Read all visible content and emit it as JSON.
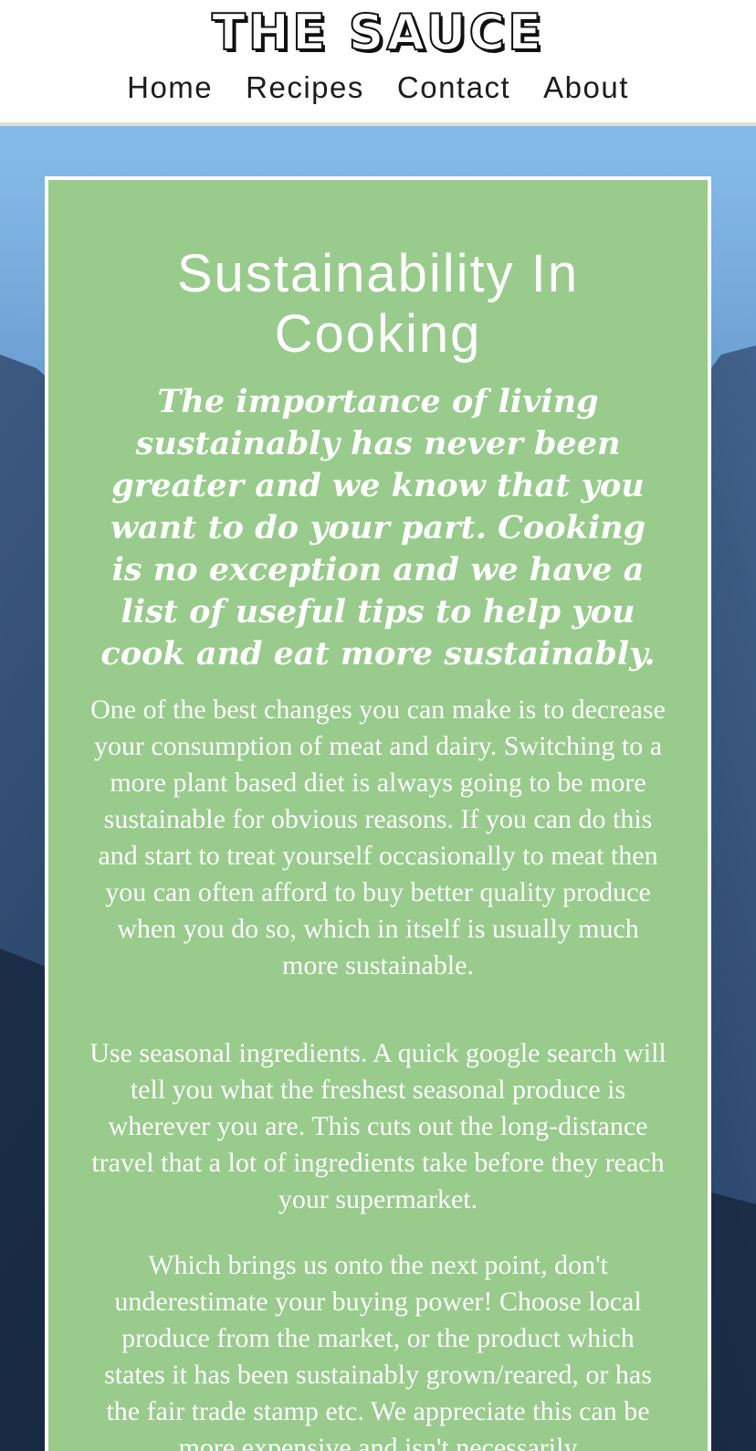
{
  "header": {
    "logo": "THE SAUCE",
    "nav": [
      "Home",
      "Recipes",
      "Contact",
      "About"
    ]
  },
  "article": {
    "title": "Sustainability In Cooking",
    "subtitle": "The importance of living sustainably has never been greater and we know that you want to do your part. Cooking is no exception and we have a list of useful tips to help you cook and eat more sustainably.",
    "paragraphs": [
      "One of the best changes you can make is to decrease your consumption of meat and dairy. Switching to a more plant based diet is always going to be more sustainable for obvious reasons. If you can do this and start to treat yourself occasionally to meat then you can often afford to buy better quality produce when you do so, which in itself is usually much more sustainable.",
      "Use seasonal ingredients. A quick google search will tell you what the freshest seasonal produce is wherever you are. This cuts out the long-distance travel that a lot of ingredients take before they reach your supermarket.",
      "Which brings us onto the next point, don't underestimate your buying power! Choose local produce from the market, or the product which states it has been sustainably grown/reared, or has the fair trade stamp etc. We appreciate this can be more expensive and isn't necessarily"
    ]
  },
  "colors": {
    "card_background": "#98cb8c",
    "card_border": "#ffffff",
    "header_background": "#ffffff",
    "nav_text": "#1c1c1c",
    "header_divider": "#dcdcdc"
  },
  "background_image": "mountain-landscape-blue-sky"
}
